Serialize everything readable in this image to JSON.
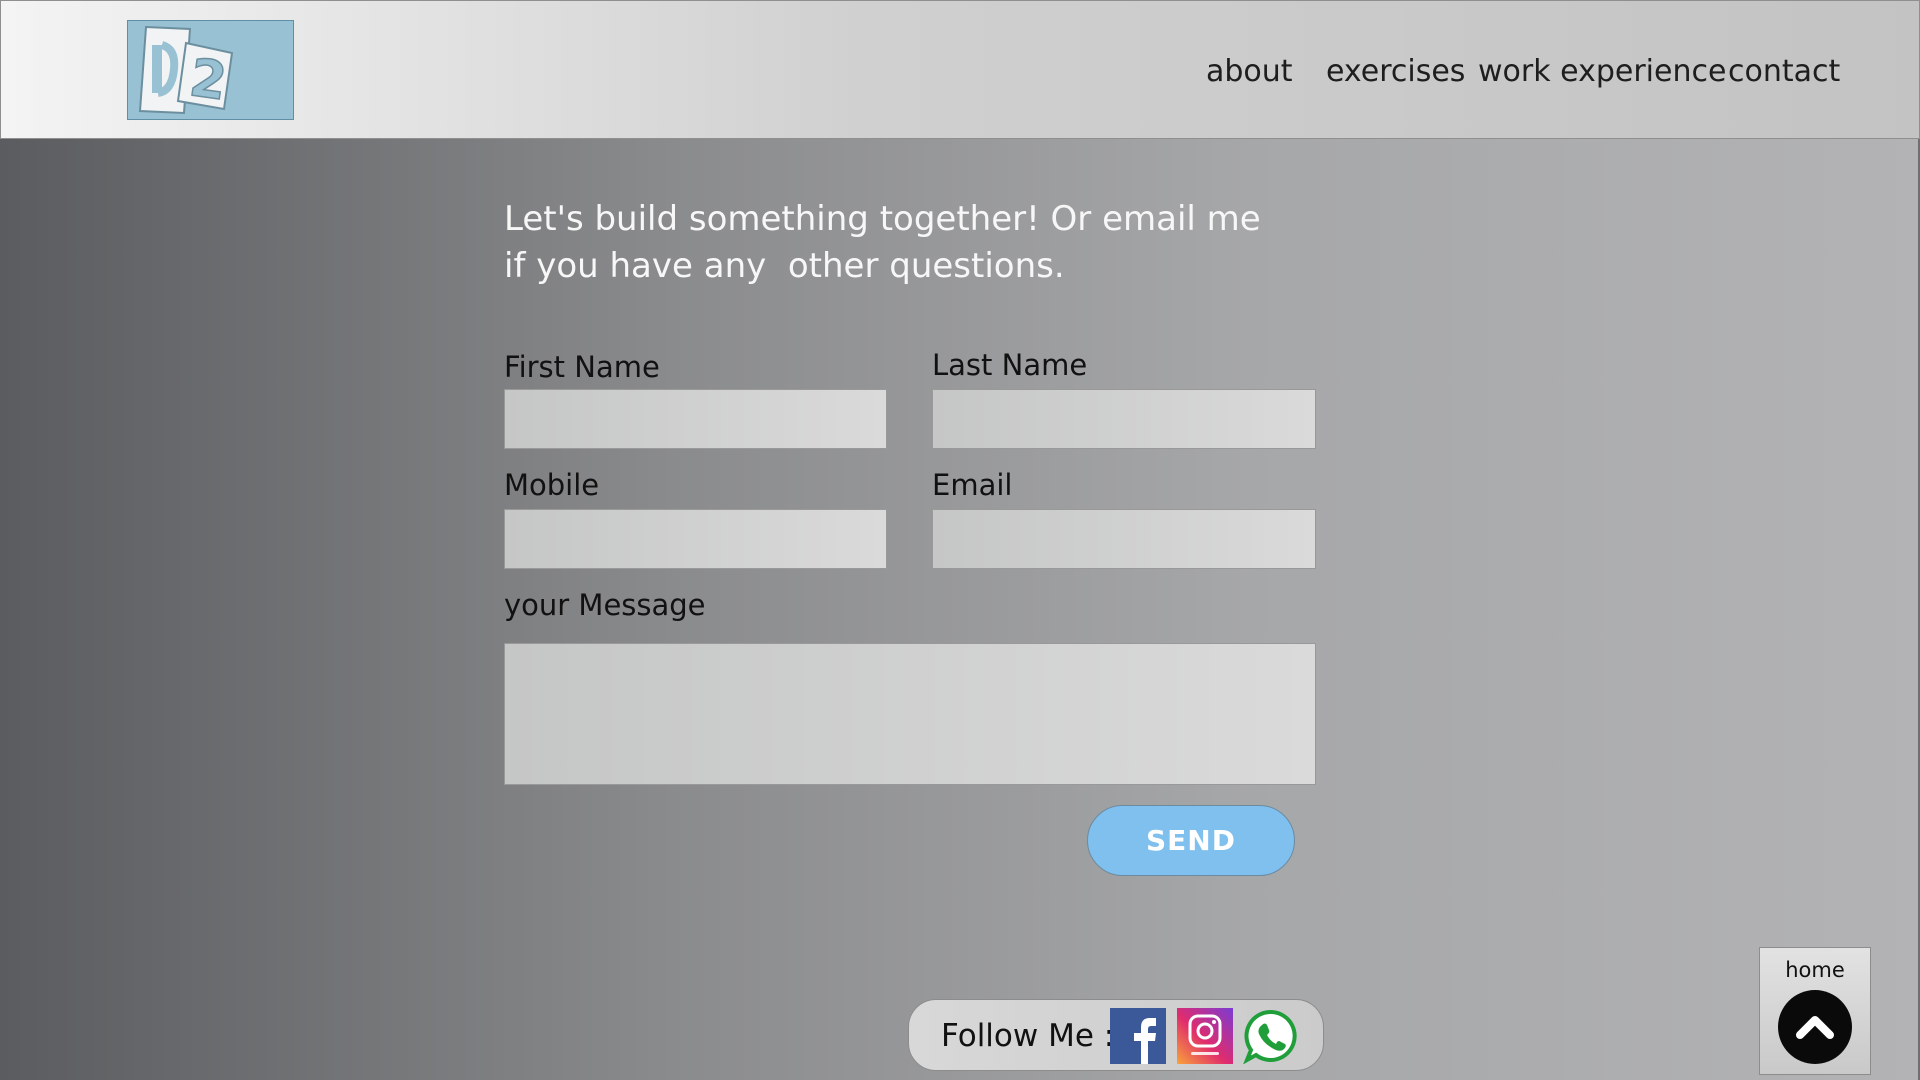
{
  "header": {
    "logo_text": "D2",
    "nav": [
      "about",
      "exercises",
      "work experience",
      "contact"
    ]
  },
  "intro": {
    "line1": "Let's build something together! Or email me",
    "line2": "if you have any  other questions."
  },
  "form": {
    "first_name_label": "First Name",
    "last_name_label": "Last Name",
    "mobile_label": "Mobile",
    "email_label": "Email",
    "message_label": "your Message",
    "first_name_value": "",
    "last_name_value": "",
    "mobile_value": "",
    "email_value": "",
    "message_value": "",
    "send_label": "SEND"
  },
  "footer": {
    "follow_label": "Follow Me :",
    "social": [
      "facebook-icon",
      "instagram-icon",
      "whatsapp-icon"
    ]
  },
  "home": {
    "label": "home",
    "icon": "chevron-up-icon"
  },
  "colors": {
    "logo_bg": "#98c1d3",
    "send_bg": "#7fc0ee",
    "facebook": "#3b5998",
    "whatsapp_green": "#1f9e3a"
  }
}
